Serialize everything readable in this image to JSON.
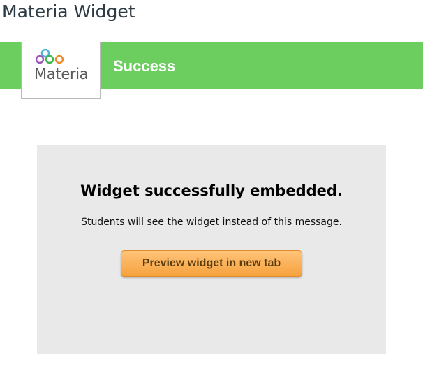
{
  "page": {
    "title": "Materia Widget"
  },
  "header": {
    "logo_text": "Materia",
    "logo_icon": "materia-rings-logo",
    "status": "Success",
    "bar_color": "#6bce5e"
  },
  "message": {
    "heading": "Widget successfully embedded.",
    "subtext": "Students will see the widget instead of this message.",
    "button_label": "Preview widget in new tab",
    "button_color": "#f6a23d"
  }
}
